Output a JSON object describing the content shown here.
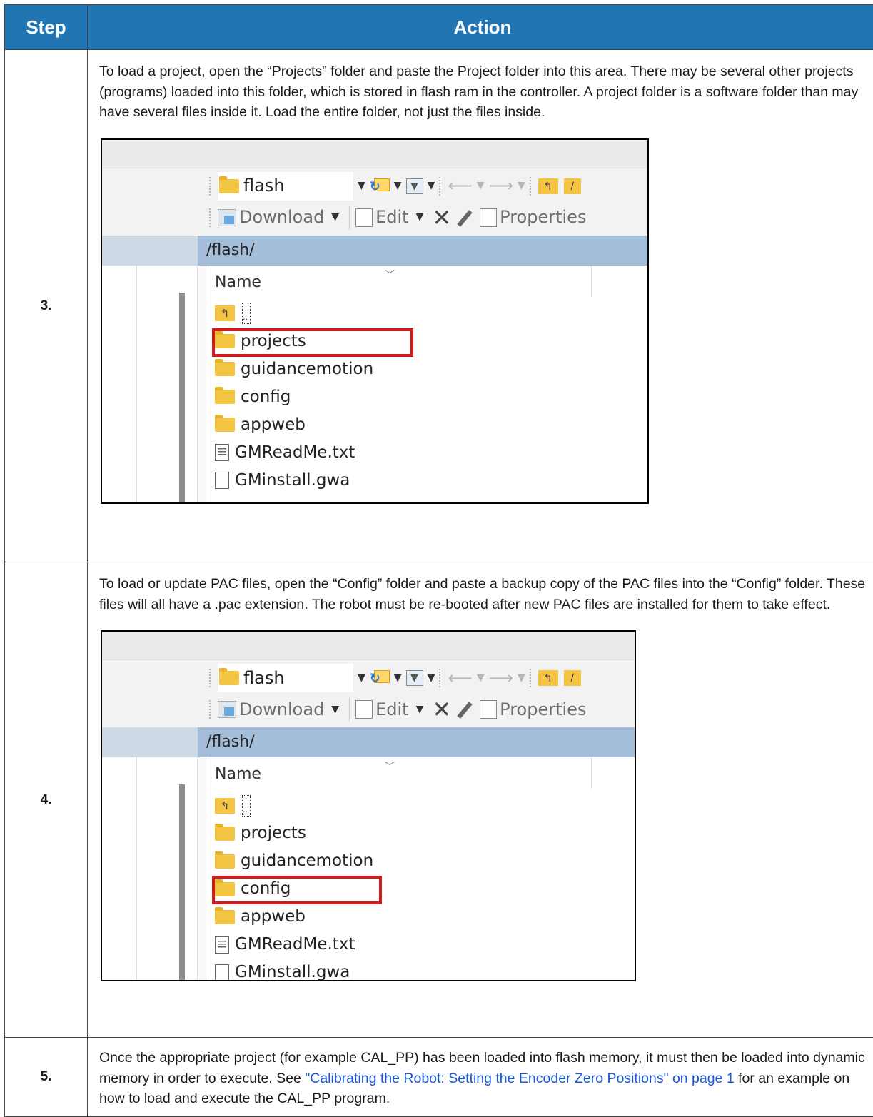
{
  "table": {
    "header_step": "Step",
    "header_action": "Action"
  },
  "rows": [
    {
      "step": "3.",
      "text": "To load a project, open the “Projects” folder and paste the Project folder into this area. There may be several other projects (programs) loaded into this folder, which is stored in flash ram in the controller. A project folder is a software folder than may have several files inside it. Load the entire folder, not just the files inside.",
      "highlight": "projects"
    },
    {
      "step": "4.",
      "text": "To load or update PAC files, open the “Config” folder and paste a backup copy of the PAC files into the “Config” folder. These files will all have a .pac extension. The robot must be re-booted after new PAC files are installed for them to take effect.",
      "highlight": "config"
    },
    {
      "step": "5.",
      "text_before": "Once the appropriate project (for example CAL_PP) has been loaded into flash memory, it must then be loaded into dynamic memory in order to execute. See ",
      "link": "\"Calibrating the Robot: Setting the Encoder Zero Positions\" on page 1",
      "text_after": " for an example on how to load and execute the CAL_PP program."
    }
  ],
  "explorer": {
    "location": "flash",
    "download_label": "Download",
    "edit_label": "Edit",
    "properties_label": "Properties",
    "path": "/flash/",
    "column_name": "Name",
    "parent_label": "..",
    "items": [
      {
        "name": "projects",
        "icon": "folder-icon"
      },
      {
        "name": "guidancemotion",
        "icon": "folder-icon"
      },
      {
        "name": "config",
        "icon": "folder-icon"
      },
      {
        "name": "appweb",
        "icon": "folder-icon"
      },
      {
        "name": "GMReadMe.txt",
        "icon": "text-file-icon"
      },
      {
        "name": "GMinstall.gwa",
        "icon": "file-icon"
      }
    ]
  },
  "colors": {
    "header_bg": "#2275b3",
    "highlight_border": "#d21a1a",
    "link": "#1a57d6"
  }
}
